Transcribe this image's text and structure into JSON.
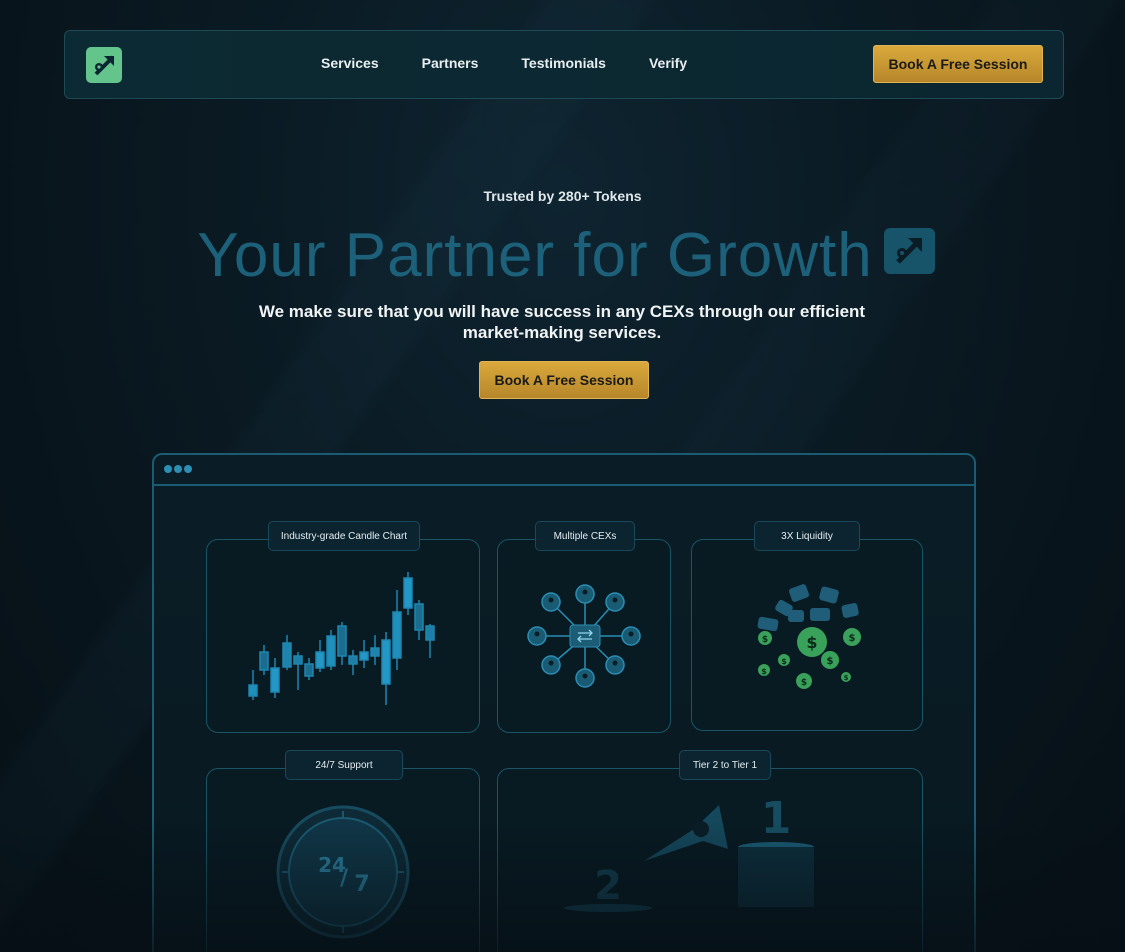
{
  "nav": {
    "logo": "growth-arrow-logo",
    "links": [
      "Services",
      "Partners",
      "Testimonials",
      "Verify"
    ],
    "cta_label": "Book A Free Session"
  },
  "hero": {
    "trusted": "Trusted by 280+ Tokens",
    "headline": "Your Partner for Growth",
    "subtitle": "We make sure that you will have success in any CEXs through our efficient market-making services.",
    "cta_label": "Book A Free Session"
  },
  "features": {
    "candle_chart_label": "Industry-grade Candle Chart",
    "multiple_cex_label": "Multiple CEXs",
    "liquidity_label": "3X Liquidity",
    "support_label": "24/7 Support",
    "support_badge_top": "24",
    "support_badge_bottom": "7",
    "tier_label": "Tier 2 to Tier 1",
    "tier_from": "2",
    "tier_to": "1"
  },
  "colors": {
    "accent_gold": "#d9a93c",
    "headline_teal": "#1c6179",
    "logo_green": "#64c58c",
    "border_teal": "#1b5c72"
  }
}
